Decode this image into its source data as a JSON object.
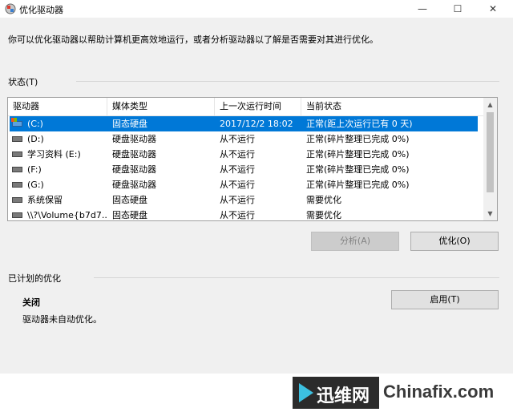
{
  "window": {
    "title": "优化驱动器",
    "minimize": "—",
    "maximize": "☐",
    "close": "✕"
  },
  "intro": "你可以优化驱动器以帮助计算机更高效地运行，或者分析驱动器以了解是否需要对其进行优化。",
  "status_section": {
    "label": "状态(T)"
  },
  "table": {
    "headers": [
      "驱动器",
      "媒体类型",
      "上一次运行时间",
      "当前状态"
    ],
    "rows": [
      {
        "drive": "(C:)",
        "media": "固态硬盘",
        "last_run": "2017/12/2 18:02",
        "status": "正常(距上次运行已有 0 天)",
        "icon": "system-drive-icon",
        "selected": true
      },
      {
        "drive": "(D:)",
        "media": "硬盘驱动器",
        "last_run": "从不运行",
        "status": "正常(碎片整理已完成 0%)",
        "icon": "hard-drive-icon"
      },
      {
        "drive": "学习资料 (E:)",
        "media": "硬盘驱动器",
        "last_run": "从不运行",
        "status": "正常(碎片整理已完成 0%)",
        "icon": "hard-drive-icon"
      },
      {
        "drive": "(F:)",
        "media": "硬盘驱动器",
        "last_run": "从不运行",
        "status": "正常(碎片整理已完成 0%)",
        "icon": "hard-drive-icon"
      },
      {
        "drive": "(G:)",
        "media": "硬盘驱动器",
        "last_run": "从不运行",
        "status": "正常(碎片整理已完成 0%)",
        "icon": "hard-drive-icon"
      },
      {
        "drive": "系统保留",
        "media": "固态硬盘",
        "last_run": "从不运行",
        "status": "需要优化",
        "icon": "hard-drive-icon"
      },
      {
        "drive": "\\\\?\\Volume{b7d7...",
        "media": "固态硬盘",
        "last_run": "从不运行",
        "status": "需要优化",
        "icon": "hard-drive-icon"
      }
    ]
  },
  "buttons": {
    "analyze": "分析(A)",
    "optimize": "优化(O)",
    "enable": "启用(T)"
  },
  "schedule": {
    "label": "已计划的优化",
    "state": "关闭",
    "description": "驱动器未自动优化。"
  },
  "watermark": {
    "cn": "迅维网",
    "en": "Chinafix.com"
  }
}
